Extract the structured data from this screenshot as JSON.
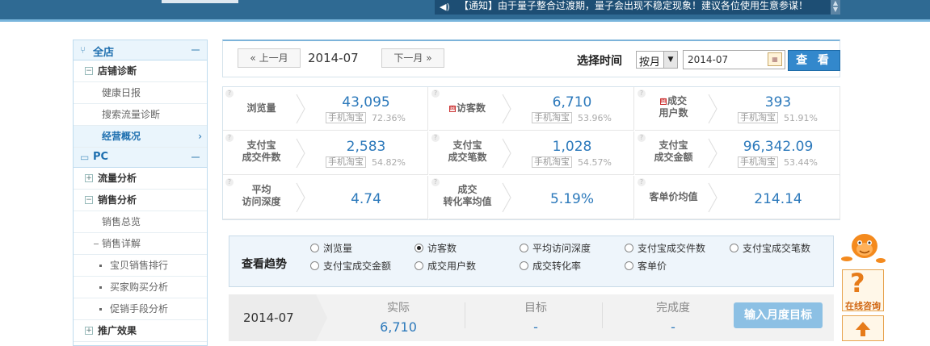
{
  "notice": {
    "text": "【通知】由于量子整合过渡期，量子会出现不稳定现象！建议各位使用生意参谋！"
  },
  "sidebar": {
    "shop_title": "全店",
    "pc_title": "PC",
    "items": [
      {
        "label": "店铺诊断"
      },
      {
        "label": "健康日报"
      },
      {
        "label": "搜索流量诊断"
      },
      {
        "label": "经营概况"
      },
      {
        "label": "流量分析"
      },
      {
        "label": "销售分析"
      },
      {
        "label": "销售总览"
      },
      {
        "label": "销售详解"
      },
      {
        "label": "宝贝销售排行"
      },
      {
        "label": "买家购买分析"
      },
      {
        "label": "促销手段分析"
      },
      {
        "label": "推广效果"
      }
    ]
  },
  "datebar": {
    "prev_label": "上一月",
    "next_label": "下一月",
    "current": "2014-07",
    "select_label": "选择时间",
    "mode_value": "按月",
    "date_value": "2014-07",
    "query_label": "查 看"
  },
  "metrics": [
    {
      "label1": "浏览量",
      "label2": "",
      "value": "43,095",
      "mobile": "手机淘宝",
      "pct": "72.36%",
      "tag": false
    },
    {
      "label1": "访客数",
      "label2": "",
      "value": "6,710",
      "mobile": "手机淘宝",
      "pct": "53.96%",
      "tag": true
    },
    {
      "label1": "成交",
      "label2": "用户数",
      "value": "393",
      "mobile": "手机淘宝",
      "pct": "51.91%",
      "tag": true
    },
    {
      "label1": "支付宝",
      "label2": "成交件数",
      "value": "2,583",
      "mobile": "手机淘宝",
      "pct": "54.82%",
      "tag": false
    },
    {
      "label1": "支付宝",
      "label2": "成交笔数",
      "value": "1,028",
      "mobile": "手机淘宝",
      "pct": "54.57%",
      "tag": false
    },
    {
      "label1": "支付宝",
      "label2": "成交金额",
      "value": "96,342.09",
      "mobile": "手机淘宝",
      "pct": "53.44%",
      "tag": false
    },
    {
      "label1": "平均",
      "label2": "访问深度",
      "value": "4.74",
      "mobile": "",
      "pct": "",
      "tag": false
    },
    {
      "label1": "成交",
      "label2": "转化率均值",
      "value": "5.19%",
      "mobile": "",
      "pct": "",
      "tag": false
    },
    {
      "label1": "客单价均值",
      "label2": "",
      "value": "214.14",
      "mobile": "",
      "pct": "",
      "tag": false
    }
  ],
  "trend": {
    "title": "查看趋势",
    "options": [
      {
        "label": "浏览量",
        "checked": false
      },
      {
        "label": "访客数",
        "checked": true
      },
      {
        "label": "平均访问深度",
        "checked": false
      },
      {
        "label": "支付宝成交件数",
        "checked": false
      },
      {
        "label": "支付宝成交笔数",
        "checked": false
      },
      {
        "label": "支付宝成交金额",
        "checked": false
      },
      {
        "label": "成交用户数",
        "checked": false
      },
      {
        "label": "成交转化率",
        "checked": false
      },
      {
        "label": "客单价",
        "checked": false
      }
    ]
  },
  "target": {
    "month": "2014-07",
    "actual_label": "实际",
    "actual_value": "6,710",
    "goal_label": "目标",
    "goal_value": "-",
    "completion_label": "完成度",
    "completion_value": "-",
    "button_label": "输入月度目标"
  },
  "help": {
    "consult_label": "在线咨询"
  }
}
